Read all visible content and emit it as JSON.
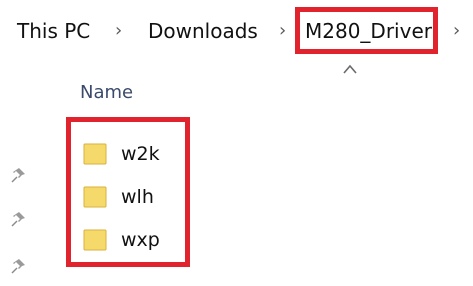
{
  "breadcrumb": {
    "items": [
      {
        "label": "This PC"
      },
      {
        "label": "Downloads"
      },
      {
        "label": "M280_Driver"
      }
    ],
    "separator": "›"
  },
  "column_headers": {
    "name": "Name"
  },
  "files": [
    {
      "name": "w2k",
      "icon": "folder-icon"
    },
    {
      "name": "wlh",
      "icon": "folder-icon"
    },
    {
      "name": "wxp",
      "icon": "folder-icon"
    }
  ],
  "colors": {
    "highlight": "#e1232e",
    "folder_fill": "#f6d96b",
    "folder_edge": "#d8b23c"
  }
}
